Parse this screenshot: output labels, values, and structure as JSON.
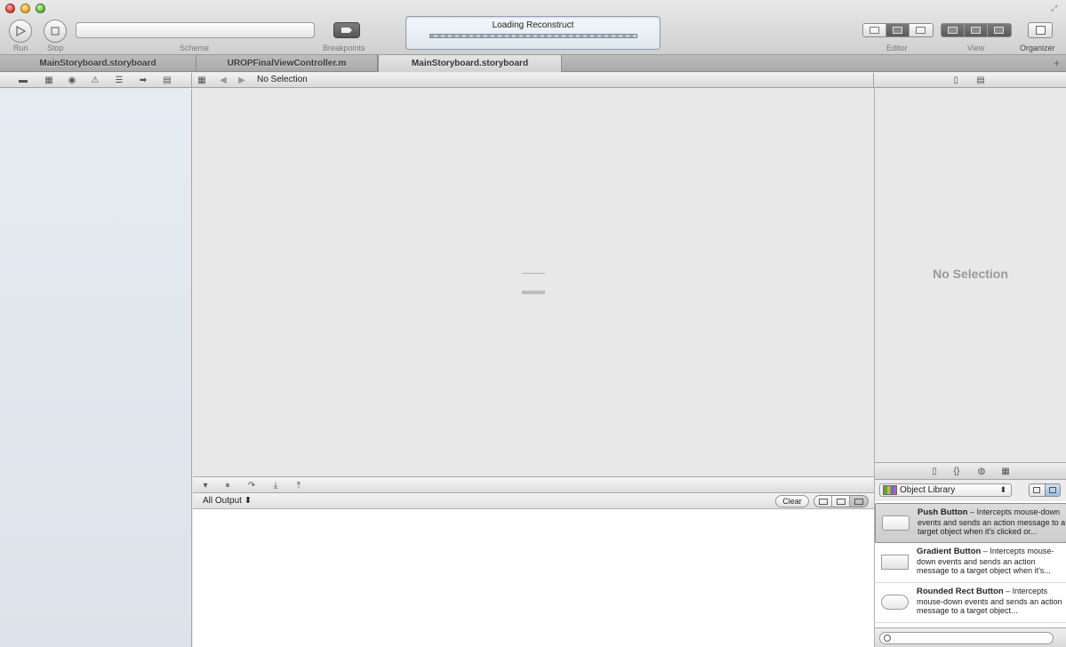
{
  "toolbar": {
    "run_label": "Run",
    "stop_label": "Stop",
    "scheme_label": "Scheme",
    "breakpoints_label": "Breakpoints",
    "activity_title": "Loading Reconstruct",
    "editor_label": "Editor",
    "view_label": "View",
    "organizer_label": "Organizer"
  },
  "tabs": [
    {
      "label": "MainStoryboard.storyboard"
    },
    {
      "label": "UROPFinalViewController.m"
    },
    {
      "label": "MainStoryboard.storyboard"
    }
  ],
  "jump_bar": {
    "selection": "No Selection"
  },
  "inspector": {
    "empty_text": "No Selection"
  },
  "console": {
    "output_filter": "All Output ⬍",
    "clear_label": "Clear"
  },
  "library": {
    "selected": "Object Library",
    "items": [
      {
        "title": "Push Button",
        "desc": " – Intercepts mouse-down events and sends an action message to a target object when it's clicked or..."
      },
      {
        "title": "Gradient Button",
        "desc": " – Intercepts mouse-down events and sends an action message to a target object when it's..."
      },
      {
        "title": "Rounded Rect Button",
        "desc": " – Intercepts mouse-down events and sends an action message to a target object..."
      }
    ]
  },
  "colors": {
    "navigator_bg": "#e4e9f0",
    "activity_bg": "#e6edf3",
    "selected_item_bg": "#d4d4d4"
  }
}
